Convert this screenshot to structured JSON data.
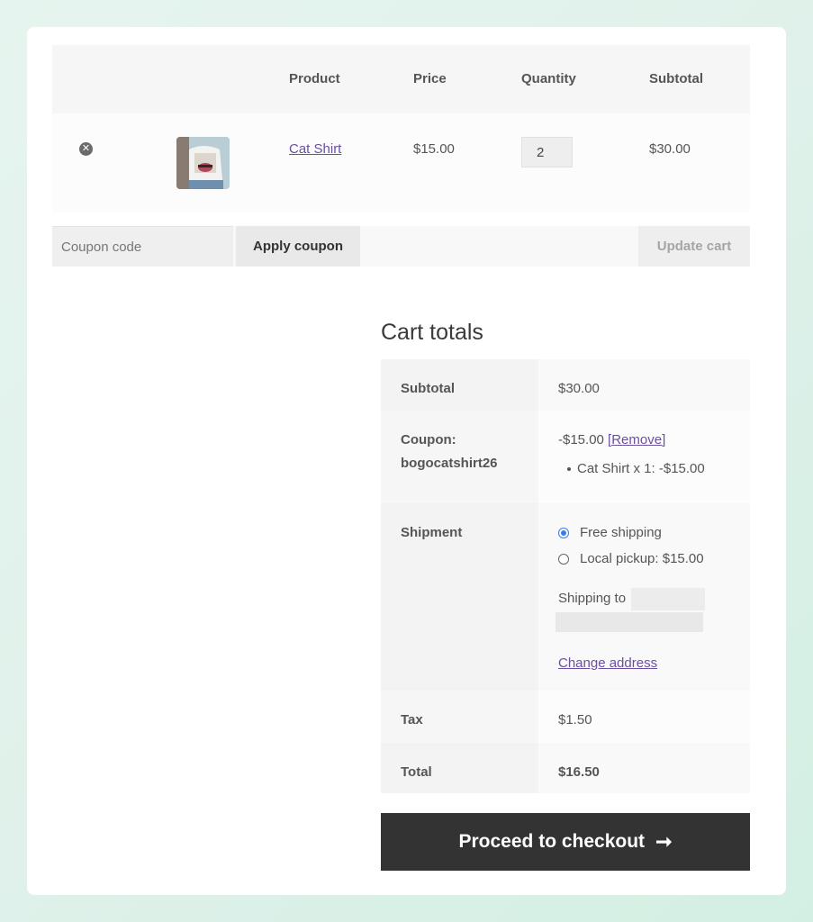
{
  "cart": {
    "headers": {
      "product": "Product",
      "price": "Price",
      "quantity": "Quantity",
      "subtotal": "Subtotal"
    },
    "items": [
      {
        "name": "Cat Shirt",
        "price": "$15.00",
        "quantity": "2",
        "subtotal": "$30.00"
      }
    ]
  },
  "actions": {
    "coupon_placeholder": "Coupon code",
    "apply_label": "Apply coupon",
    "update_label": "Update cart"
  },
  "totals": {
    "title": "Cart totals",
    "subtotal_label": "Subtotal",
    "subtotal_value": "$30.00",
    "coupon_label": "Coupon:",
    "coupon_code": "bogocatshirt26",
    "coupon_value": "-$15.00",
    "remove_label": "[Remove]",
    "coupon_item": "Cat Shirt x 1: -$15.00",
    "shipment_label": "Shipment",
    "shipping_options": [
      {
        "label": "Free shipping",
        "checked": true
      },
      {
        "label": "Local pickup: $15.00",
        "checked": false
      }
    ],
    "shipping_to": "Shipping to",
    "change_address": "Change address",
    "tax_label": "Tax",
    "tax_value": "$1.50",
    "total_label": "Total",
    "total_value": "$16.50"
  },
  "checkout": {
    "label": "Proceed to checkout"
  },
  "colors": {
    "link": "#6b4fa1",
    "button_dark": "#333333",
    "radio_active": "#3b7ce8"
  }
}
